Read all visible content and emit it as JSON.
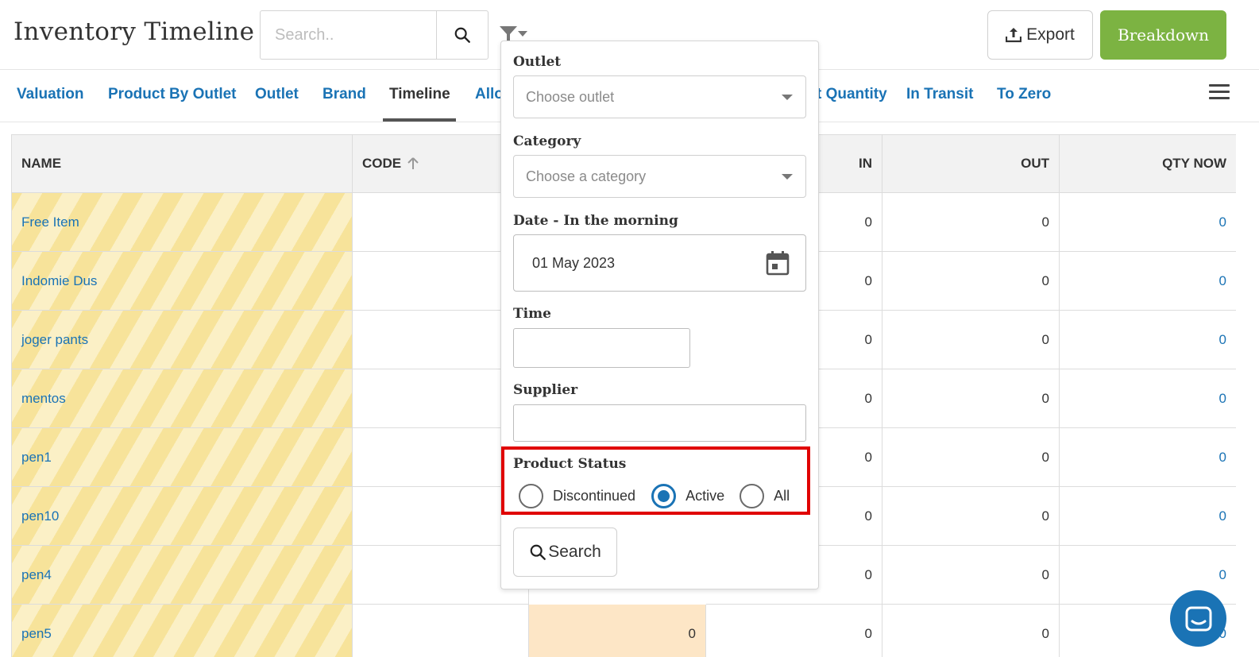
{
  "app": {
    "title": "Inventory Timeline"
  },
  "search": {
    "placeholder": "Search.."
  },
  "actions": {
    "export_label": "Export",
    "breakdown_label": "Breakdown"
  },
  "colors": {
    "accent": "#1a73b5",
    "breakdown": "#7cb342",
    "highlight": "#e00000"
  },
  "tabs": [
    {
      "label": "Valuation"
    },
    {
      "label": "Product By Outlet"
    },
    {
      "label": "Outlet"
    },
    {
      "label": "Brand"
    },
    {
      "label": "Timeline",
      "active": true
    },
    {
      "label": "Allo"
    },
    {
      "label": "t Quantity"
    },
    {
      "label": "In Transit"
    },
    {
      "label": "To Zero"
    }
  ],
  "table": {
    "headers": {
      "name": "NAME",
      "code": "CODE",
      "in": "IN",
      "out": "OUT",
      "qty_now": "QTY NOW"
    },
    "rows": [
      {
        "name": "Free Item",
        "in": "0",
        "out": "0",
        "qty_now": "0"
      },
      {
        "name": "Indomie Dus",
        "in": "0",
        "out": "0",
        "qty_now": "0"
      },
      {
        "name": "joger pants",
        "in": "0",
        "out": "0",
        "qty_now": "0"
      },
      {
        "name": "mentos",
        "in": "0",
        "out": "0",
        "qty_now": "0"
      },
      {
        "name": "pen1",
        "in": "0",
        "out": "0",
        "qty_now": "0"
      },
      {
        "name": "pen10",
        "in": "0",
        "out": "0",
        "qty_now": "0"
      },
      {
        "name": "pen4",
        "in": "0",
        "out": "0",
        "qty_now": "0"
      },
      {
        "name": "pen5",
        "qty_before": "0",
        "in": "0",
        "out": "0",
        "qty_now": "0"
      }
    ]
  },
  "filter": {
    "outlet_label": "Outlet",
    "outlet_placeholder": "Choose outlet",
    "category_label": "Category",
    "category_placeholder": "Choose a category",
    "date_label": "Date - In the morning",
    "date_value": "01 May 2023",
    "time_label": "Time",
    "time_value": "",
    "supplier_label": "Supplier",
    "supplier_value": "",
    "status_label": "Product Status",
    "status_options": [
      {
        "label": "Discontinued",
        "checked": false
      },
      {
        "label": "Active",
        "checked": true
      },
      {
        "label": "All",
        "checked": false
      }
    ],
    "search_label": "Search"
  }
}
